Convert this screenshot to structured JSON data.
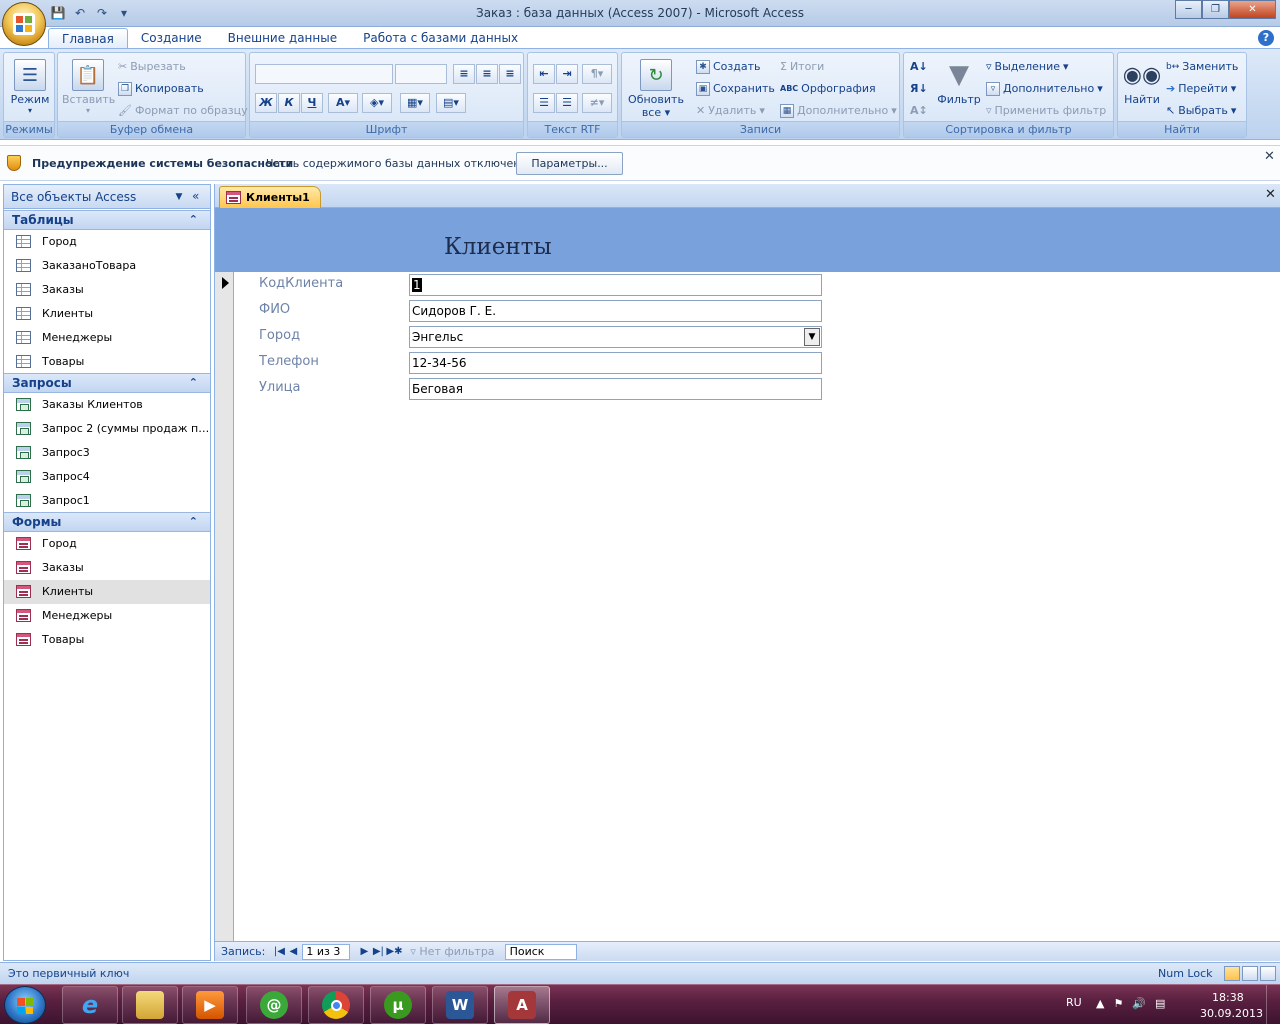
{
  "window": {
    "title": "Заказ : база данных (Access 2007) - Microsoft Access",
    "colors": {
      "accent": "#79a2dc",
      "ribbon": "#c6d9f1",
      "doc_tab": "#ffc64d",
      "taskbar": "#5a2040"
    }
  },
  "ribbon_tabs": [
    "Главная",
    "Создание",
    "Внешние данные",
    "Работа с базами данных"
  ],
  "ribbon": {
    "modes": {
      "label": "Режимы",
      "view": "Режим"
    },
    "clipboard": {
      "label": "Буфер обмена",
      "paste": "Вставить",
      "cut": "Вырезать",
      "copy": "Копировать",
      "format_painter": "Формат по образцу"
    },
    "font": {
      "label": "Шрифт",
      "bold": "Ж",
      "italic": "К",
      "underline": "Ч"
    },
    "rtf": {
      "label": "Текст RTF"
    },
    "records": {
      "label": "Записи",
      "refresh": "Обновить",
      "refresh2": "все",
      "new": "Создать",
      "save": "Сохранить",
      "delete": "Удалить",
      "totals": "Итоги",
      "spelling": "Орфография",
      "more": "Дополнительно"
    },
    "sort_filter": {
      "label": "Сортировка и фильтр",
      "filter": "Фильтр",
      "selection": "Выделение",
      "advanced": "Дополнительно",
      "apply": "Применить фильтр"
    },
    "find": {
      "label": "Найти",
      "find": "Найти",
      "replace": "Заменить",
      "goto": "Перейти",
      "select": "Выбрать"
    }
  },
  "security_bar": {
    "title": "Предупреждение системы безопасности",
    "message": "Часть содержимого базы данных отключено",
    "button": "Параметры..."
  },
  "nav_pane": {
    "title": "Все объекты Access",
    "sections": [
      {
        "name": "Таблицы",
        "items": [
          "Город",
          "ЗаказаноТовара",
          "Заказы",
          "Клиенты",
          "Менеджеры",
          "Товары"
        ]
      },
      {
        "name": "Запросы",
        "items": [
          "Заказы Клиентов",
          "Запрос 2 (суммы продаж по ...",
          "Запрос3",
          "Запрос4",
          "Запрос1"
        ]
      },
      {
        "name": "Формы",
        "items": [
          "Город",
          "Заказы",
          "Клиенты",
          "Менеджеры",
          "Товары"
        ]
      }
    ]
  },
  "document": {
    "tab": "Клиенты1",
    "form_title": "Клиенты",
    "fields": [
      {
        "label": "КодКлиента",
        "value": "1"
      },
      {
        "label": "ФИО",
        "value": "Сидоров Г. Е."
      },
      {
        "label": "Город",
        "value": "Энгельс"
      },
      {
        "label": "Телефон",
        "value": "12-34-56"
      },
      {
        "label": "Улица",
        "value": "Беговая"
      }
    ]
  },
  "record_nav": {
    "label": "Запись:",
    "position": "1 из 3",
    "filter": "Нет фильтра",
    "search": "Поиск"
  },
  "status_bar": {
    "message": "Это первичный ключ",
    "numlock": "Num Lock"
  },
  "taskbar": {
    "language": "RU",
    "time": "18:38",
    "date": "30.09.2013"
  }
}
